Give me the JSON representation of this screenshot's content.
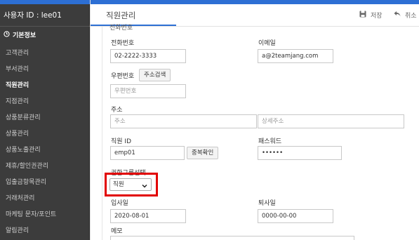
{
  "sidebar": {
    "user_label": "사용자 ID : lee01",
    "section_title": "기본정보",
    "items": [
      {
        "label": "고객관리"
      },
      {
        "label": "부서관리"
      },
      {
        "label": "직원관리"
      },
      {
        "label": "지점관리"
      },
      {
        "label": "상품분류관리"
      },
      {
        "label": "상품관리"
      },
      {
        "label": "상품노출관리"
      },
      {
        "label": "제휴/할인권관리"
      },
      {
        "label": "입출금항목관리"
      },
      {
        "label": "거래처관리"
      },
      {
        "label": "마케팅 문자/포인트"
      },
      {
        "label": "알림관리"
      }
    ],
    "active_item": "직원관리"
  },
  "header": {
    "title": "직원관리",
    "save_label": "저장",
    "cancel_label": "취소"
  },
  "form": {
    "cut_label": "전화번호",
    "phone_label": "전화번호",
    "phone_value": "02-2222-3333",
    "email_label": "이메일",
    "email_value": "a@2teamjang.com",
    "zip_label": "우편번호",
    "zip_search_button": "주소검색",
    "zip_placeholder": "우편번호",
    "address_label": "주소",
    "address_placeholder": "주소",
    "address_detail_placeholder": "상세주소",
    "staff_id_label": "직원 ID",
    "staff_id_value": "emp01",
    "dup_check_button": "중복확인",
    "password_label": "패스워드",
    "password_value": "••••••",
    "role_label": "권한그룹선택",
    "role_selected": "직원",
    "hire_date_label": "입사일",
    "hire_date_value": "2020-08-01",
    "leave_date_label": "퇴사일",
    "leave_date_value": "0000-00-00",
    "memo_label": "메모"
  },
  "colors": {
    "accent": "#2d6fd4",
    "sidebar_bg": "#3c3c3c",
    "highlight": "#e20000"
  }
}
